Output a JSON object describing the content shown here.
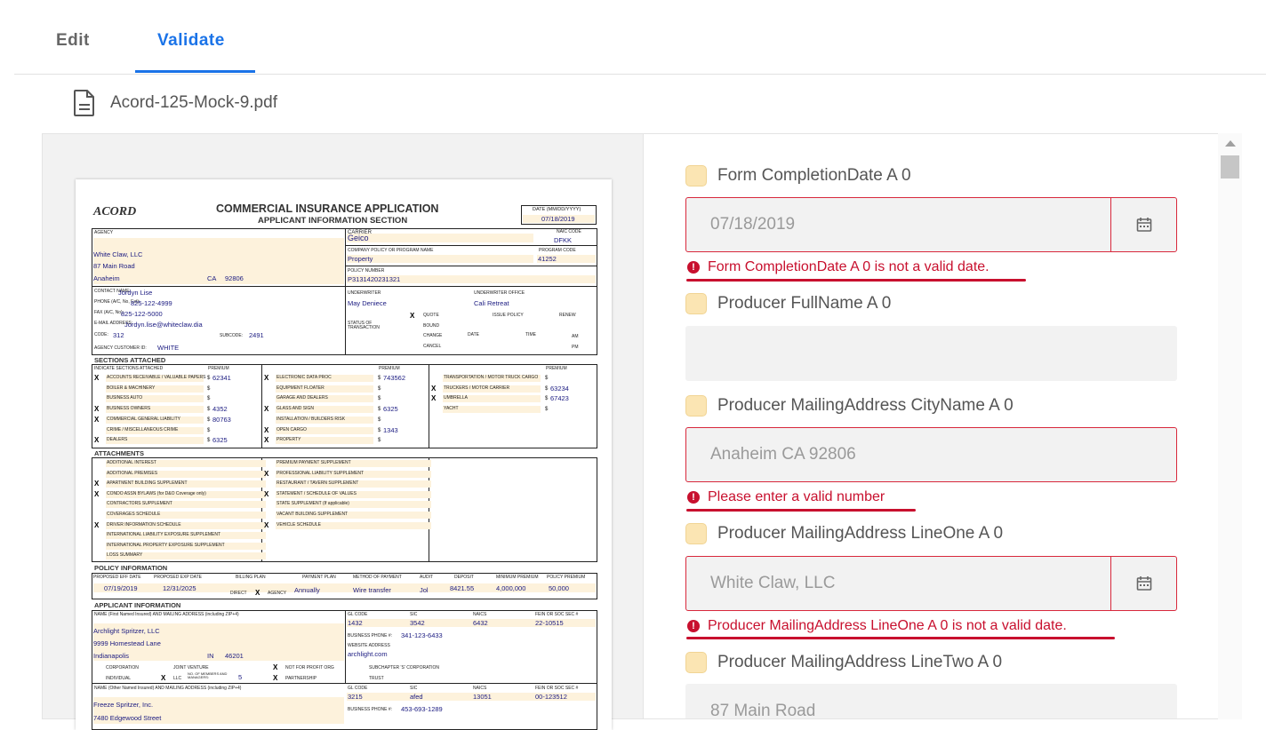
{
  "tabs": {
    "edit": "Edit",
    "validate": "Validate"
  },
  "file": {
    "name": "Acord-125-Mock-9.pdf"
  },
  "doc": {
    "logo": "ACORD",
    "title": "COMMERCIAL INSURANCE APPLICATION",
    "subtitle": "APPLICANT INFORMATION SECTION",
    "date_label": "DATE (MM/DD/YYYY)",
    "date": "07/18/2019",
    "agency_label": "AGENCY",
    "carrier_label": "CARRIER",
    "carrier": "Geico",
    "naic_label": "NAIC CODE",
    "naic": "DFKK",
    "agency_name": "White Claw, LLC",
    "agency_street": "87 Main Road",
    "agency_city": "Anaheim",
    "agency_state": "CA",
    "agency_zip": "92806",
    "policy_prog_label": "COMPANY POLICY OR PROGRAM NAME",
    "policy_prog": "Property",
    "program_code_label": "PROGRAM CODE",
    "program_code": "41252",
    "policy_number_label": "POLICY NUMBER",
    "policy_number": "P3131420231321",
    "contact_label": "CONTACT NAME:",
    "contact": "Jordyn Lise",
    "phone_label": "PHONE (A/C, No, Ext):",
    "phone": "825-122-4999",
    "fax_label": "FAX (A/C, No):",
    "fax": "825-122-5000",
    "email_label": "E-MAIL ADDRESS:",
    "email": "Jordyn.lise@whiteclaw.dia",
    "code_label": "CODE:",
    "code": "312",
    "subcode_label": "SUBCODE:",
    "subcode": "2491",
    "agency_cust_label": "AGENCY CUSTOMER ID:",
    "agency_cust": "WHITE",
    "underwriter_label": "UNDERWRITER",
    "underwriter": "May Deniece",
    "uw_office_label": "UNDERWRITER OFFICE",
    "uw_office": "Cali Retreat",
    "status_label": "STATUS OF TRANSACTION",
    "quote": "QUOTE",
    "issue_policy": "ISSUE POLICY",
    "renew": "RENEW",
    "bound": "BOUND",
    "change": "CHANGE",
    "cancel": "CANCEL",
    "date_col": "DATE",
    "time_col": "TIME",
    "am": "AM",
    "pm": "PM",
    "sections_label": "SECTIONS ATTACHED",
    "indicate_label": "INDICATE SECTIONS ATTACHED",
    "premium_label": "PREMIUM",
    "sections_left": [
      {
        "label": "ACCOUNTS RECEIVABLE / VALUABLE PAPERS",
        "x": true,
        "prem": "62341"
      },
      {
        "label": "BOILER & MACHINERY",
        "x": false,
        "prem": ""
      },
      {
        "label": "BUSINESS AUTO",
        "x": false,
        "prem": ""
      },
      {
        "label": "BUSINESS OWNERS",
        "x": true,
        "prem": "4352"
      },
      {
        "label": "COMMERCIAL GENERAL LIABILITY",
        "x": true,
        "prem": "80763"
      },
      {
        "label": "CRIME / MISCELLANEOUS CRIME",
        "x": false,
        "prem": ""
      },
      {
        "label": "DEALERS",
        "x": true,
        "prem": "6325"
      }
    ],
    "sections_mid": [
      {
        "label": "ELECTRONIC DATA PROC",
        "x": true,
        "prem": "743562"
      },
      {
        "label": "EQUIPMENT FLOATER",
        "x": false,
        "prem": ""
      },
      {
        "label": "GARAGE AND DEALERS",
        "x": false,
        "prem": ""
      },
      {
        "label": "GLASS AND SIGN",
        "x": true,
        "prem": "6325"
      },
      {
        "label": "INSTALLATION / BUILDERS RISK",
        "x": false,
        "prem": ""
      },
      {
        "label": "OPEN CARGO",
        "x": true,
        "prem": "1343"
      },
      {
        "label": "PROPERTY",
        "x": true,
        "prem": ""
      }
    ],
    "sections_right": [
      {
        "label": "TRANSPORTATION / MOTOR TRUCK CARGO",
        "x": false,
        "prem": ""
      },
      {
        "label": "TRUCKERS / MOTOR CARRIER",
        "x": true,
        "prem": "63234"
      },
      {
        "label": "UMBRELLA",
        "x": true,
        "prem": "67423"
      },
      {
        "label": "YACHT",
        "x": false,
        "prem": ""
      }
    ],
    "attachments_label": "ATTACHMENTS",
    "attach_left": [
      {
        "label": "ADDITIONAL INTEREST",
        "x": false
      },
      {
        "label": "ADDITIONAL PREMISES",
        "x": false
      },
      {
        "label": "APARTMENT BUILDING SUPPLEMENT",
        "x": true
      },
      {
        "label": "CONDO ASSN BYLAWS (for D&O Coverage only)",
        "x": true
      },
      {
        "label": "CONTRACTORS SUPPLEMENT",
        "x": false
      },
      {
        "label": "COVERAGES SCHEDULE",
        "x": false
      },
      {
        "label": "DRIVER INFORMATION SCHEDULE",
        "x": true
      },
      {
        "label": "INTERNATIONAL LIABILITY EXPOSURE SUPPLEMENT",
        "x": false
      },
      {
        "label": "INTERNATIONAL PROPERTY EXPOSURE SUPPLEMENT",
        "x": false
      },
      {
        "label": "LOSS SUMMARY",
        "x": false
      }
    ],
    "attach_right": [
      {
        "label": "PREMIUM PAYMENT SUPPLEMENT",
        "x": false
      },
      {
        "label": "PROFESSIONAL LIABILITY SUPPLEMENT",
        "x": true
      },
      {
        "label": "RESTAURANT / TAVERN SUPPLEMENT",
        "x": false
      },
      {
        "label": "STATEMENT / SCHEDULE OF VALUES",
        "x": true
      },
      {
        "label": "STATE SUPPLEMENT (If applicable)",
        "x": false
      },
      {
        "label": "VACANT BUILDING SUPPLEMENT",
        "x": false
      },
      {
        "label": "VEHICLE SCHEDULE",
        "x": true
      }
    ],
    "policy_info_label": "POLICY INFORMATION",
    "pi_eff_label": "PROPOSED EFF DATE",
    "pi_exp_label": "PROPOSED EXP DATE",
    "pi_billing_label": "BILLING PLAN",
    "pi_payplan_label": "PAYMENT PLAN",
    "pi_method_label": "METHOD OF PAYMENT",
    "pi_audit_label": "AUDIT",
    "pi_deposit_label": "DEPOSIT",
    "pi_min_label": "MINIMUM PREMIUM",
    "pi_prem_label": "POLICY PREMIUM",
    "pi_eff": "07/19/2019",
    "pi_exp": "12/31/2025",
    "pi_direct": "DIRECT",
    "pi_agency": "AGENCY",
    "pi_payplan": "Annually",
    "pi_method": "Wire transfer",
    "pi_audit": "Jol",
    "pi_deposit": "8421.55",
    "pi_min": "4,000,000",
    "pi_prem": "50,000",
    "app_info_label": "APPLICANT INFORMATION",
    "ai_name_label": "NAME (First Named Insured) AND MAILING ADDRESS (including ZIP+4)",
    "ai_gl_label": "GL CODE",
    "ai_sic_label": "SIC",
    "ai_naics_label": "NAICS",
    "ai_fein_label": "FEIN OR SOC SEC #",
    "ai_gl": "1432",
    "ai_sic": "3542",
    "ai_naics": "6432",
    "ai_fein": "22-10515",
    "ai_name": "Archlight Spritzer, LLC",
    "ai_street": "9999 Homestead Lane",
    "ai_city": "Indianapolis",
    "ai_state": "IN",
    "ai_zip": "46201",
    "ai_bphone_label": "BUSINESS PHONE #:",
    "ai_bphone": "341-123-6433",
    "ai_web_label": "WEBSITE ADDRESS",
    "ai_web": "archlight.com",
    "ai_corp": "CORPORATION",
    "ai_jv": "JOINT VENTURE",
    "ai_nfp": "NOT FOR PROFIT ORG",
    "ai_subs": "SUBCHAPTER 'S' CORPORATION",
    "ai_indiv": "INDIVIDUAL",
    "ai_llc": "LLC",
    "ai_members": "NO. OF MEMBERS AND MANAGERS:",
    "ai_members_val": "5",
    "ai_partner": "PARTNERSHIP",
    "ai_trust": "TRUST",
    "ai2_name_label": "NAME (Other Named Insured) AND MAILING ADDRESS (including ZIP+4)",
    "ai2_gl": "3215",
    "ai2_sic": "afed",
    "ai2_naics": "13051",
    "ai2_fein": "00-123512",
    "ai2_name": "Freeze Spritzer, Inc.",
    "ai2_street": "7480 Edgewood Street",
    "ai2_bphone": "453-693-1289"
  },
  "form_fields": [
    {
      "label": "Form CompletionDate A 0",
      "value": "07/18/2019",
      "state": "error",
      "calendar": true,
      "error": "Form CompletionDate A 0 is not a valid date."
    },
    {
      "label": "Producer FullName A 0",
      "value": "",
      "state": "plain",
      "calendar": false,
      "error": ""
    },
    {
      "label": "Producer MailingAddress CityName A 0",
      "value": "Anaheim CA 92806",
      "state": "error",
      "calendar": false,
      "error": "Please enter a valid number"
    },
    {
      "label": "Producer MailingAddress LineOne A 0",
      "value": "White Claw, LLC",
      "state": "error",
      "calendar": true,
      "error": "Producer MailingAddress LineOne A 0 is not a valid date."
    },
    {
      "label": "Producer MailingAddress LineTwo A 0",
      "value": "87 Main Road",
      "state": "plain",
      "calendar": false,
      "error": ""
    }
  ],
  "colors": {
    "accent": "#1a73e8",
    "error": "#c8102e",
    "checkbox": "#fbe5b3",
    "doc_highlight": "#fdf2dc"
  },
  "icons": {
    "file": "file-document-icon",
    "calendar": "calendar-icon",
    "error": "error-icon",
    "scroll_up": "scroll-up-arrow-icon"
  }
}
